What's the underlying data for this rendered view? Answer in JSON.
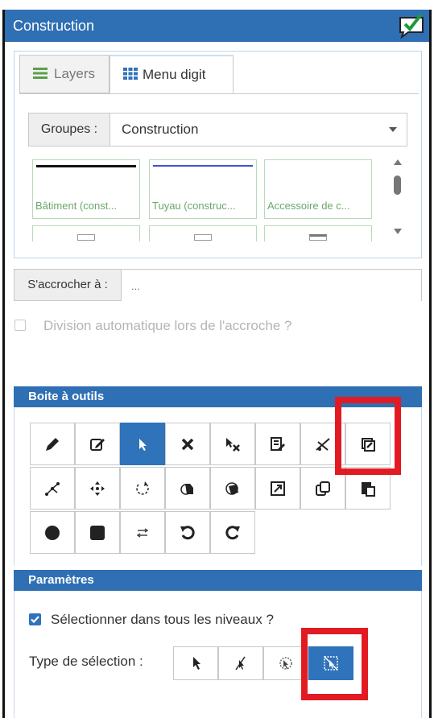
{
  "window": {
    "title": "Construction"
  },
  "tabs": [
    {
      "label": "Layers",
      "icon": "list-icon",
      "active": false
    },
    {
      "label": "Menu digit",
      "icon": "grid-icon",
      "active": true
    }
  ],
  "groups": {
    "label": "Groupes :",
    "value": "Construction"
  },
  "symbols": [
    {
      "label": "Bâtiment (const...",
      "line_color": "#111111"
    },
    {
      "label": "Tuyau (construc...",
      "line_color": "#3f4fd6"
    },
    {
      "label": "Accessoire de c...",
      "line_color": ""
    }
  ],
  "snap": {
    "label": "S'accrocher à :",
    "placeholder": "..."
  },
  "auto_split": {
    "label": "Division automatique lors de l'accroche ?",
    "checked": false
  },
  "toolbox": {
    "title": "Boite à outils",
    "tools": [
      "pencil-icon",
      "edit-icon",
      "pointer-icon",
      "delete-icon",
      "delete-selection-icon",
      "edit-attributes-icon",
      "cut-icon",
      "edit-multi-icon",
      "split-node-icon",
      "move-icon",
      "rotate-icon",
      "merge-icon",
      "merge-alt-icon",
      "scale-icon",
      "copy-icon",
      "paste-icon",
      "circle-icon",
      "square-icon",
      "reverse-icon",
      "undo-icon",
      "redo-icon"
    ],
    "active_tool": "pointer-icon"
  },
  "params": {
    "title": "Paramètres",
    "select_all_levels": {
      "label": "Sélectionner dans tous les niveaux ?",
      "checked": true
    },
    "selection_type": {
      "label": "Type de sélection :",
      "options": [
        "select-pointer-icon",
        "select-lasso-icon",
        "select-polygon-icon",
        "select-rectangle-icon"
      ],
      "active": "select-rectangle-icon"
    }
  },
  "colors": {
    "accent": "#2f6fb3",
    "active_tool": "#2f73ba",
    "highlight": "#e21b23",
    "symbol_label": "#6aa86a"
  }
}
